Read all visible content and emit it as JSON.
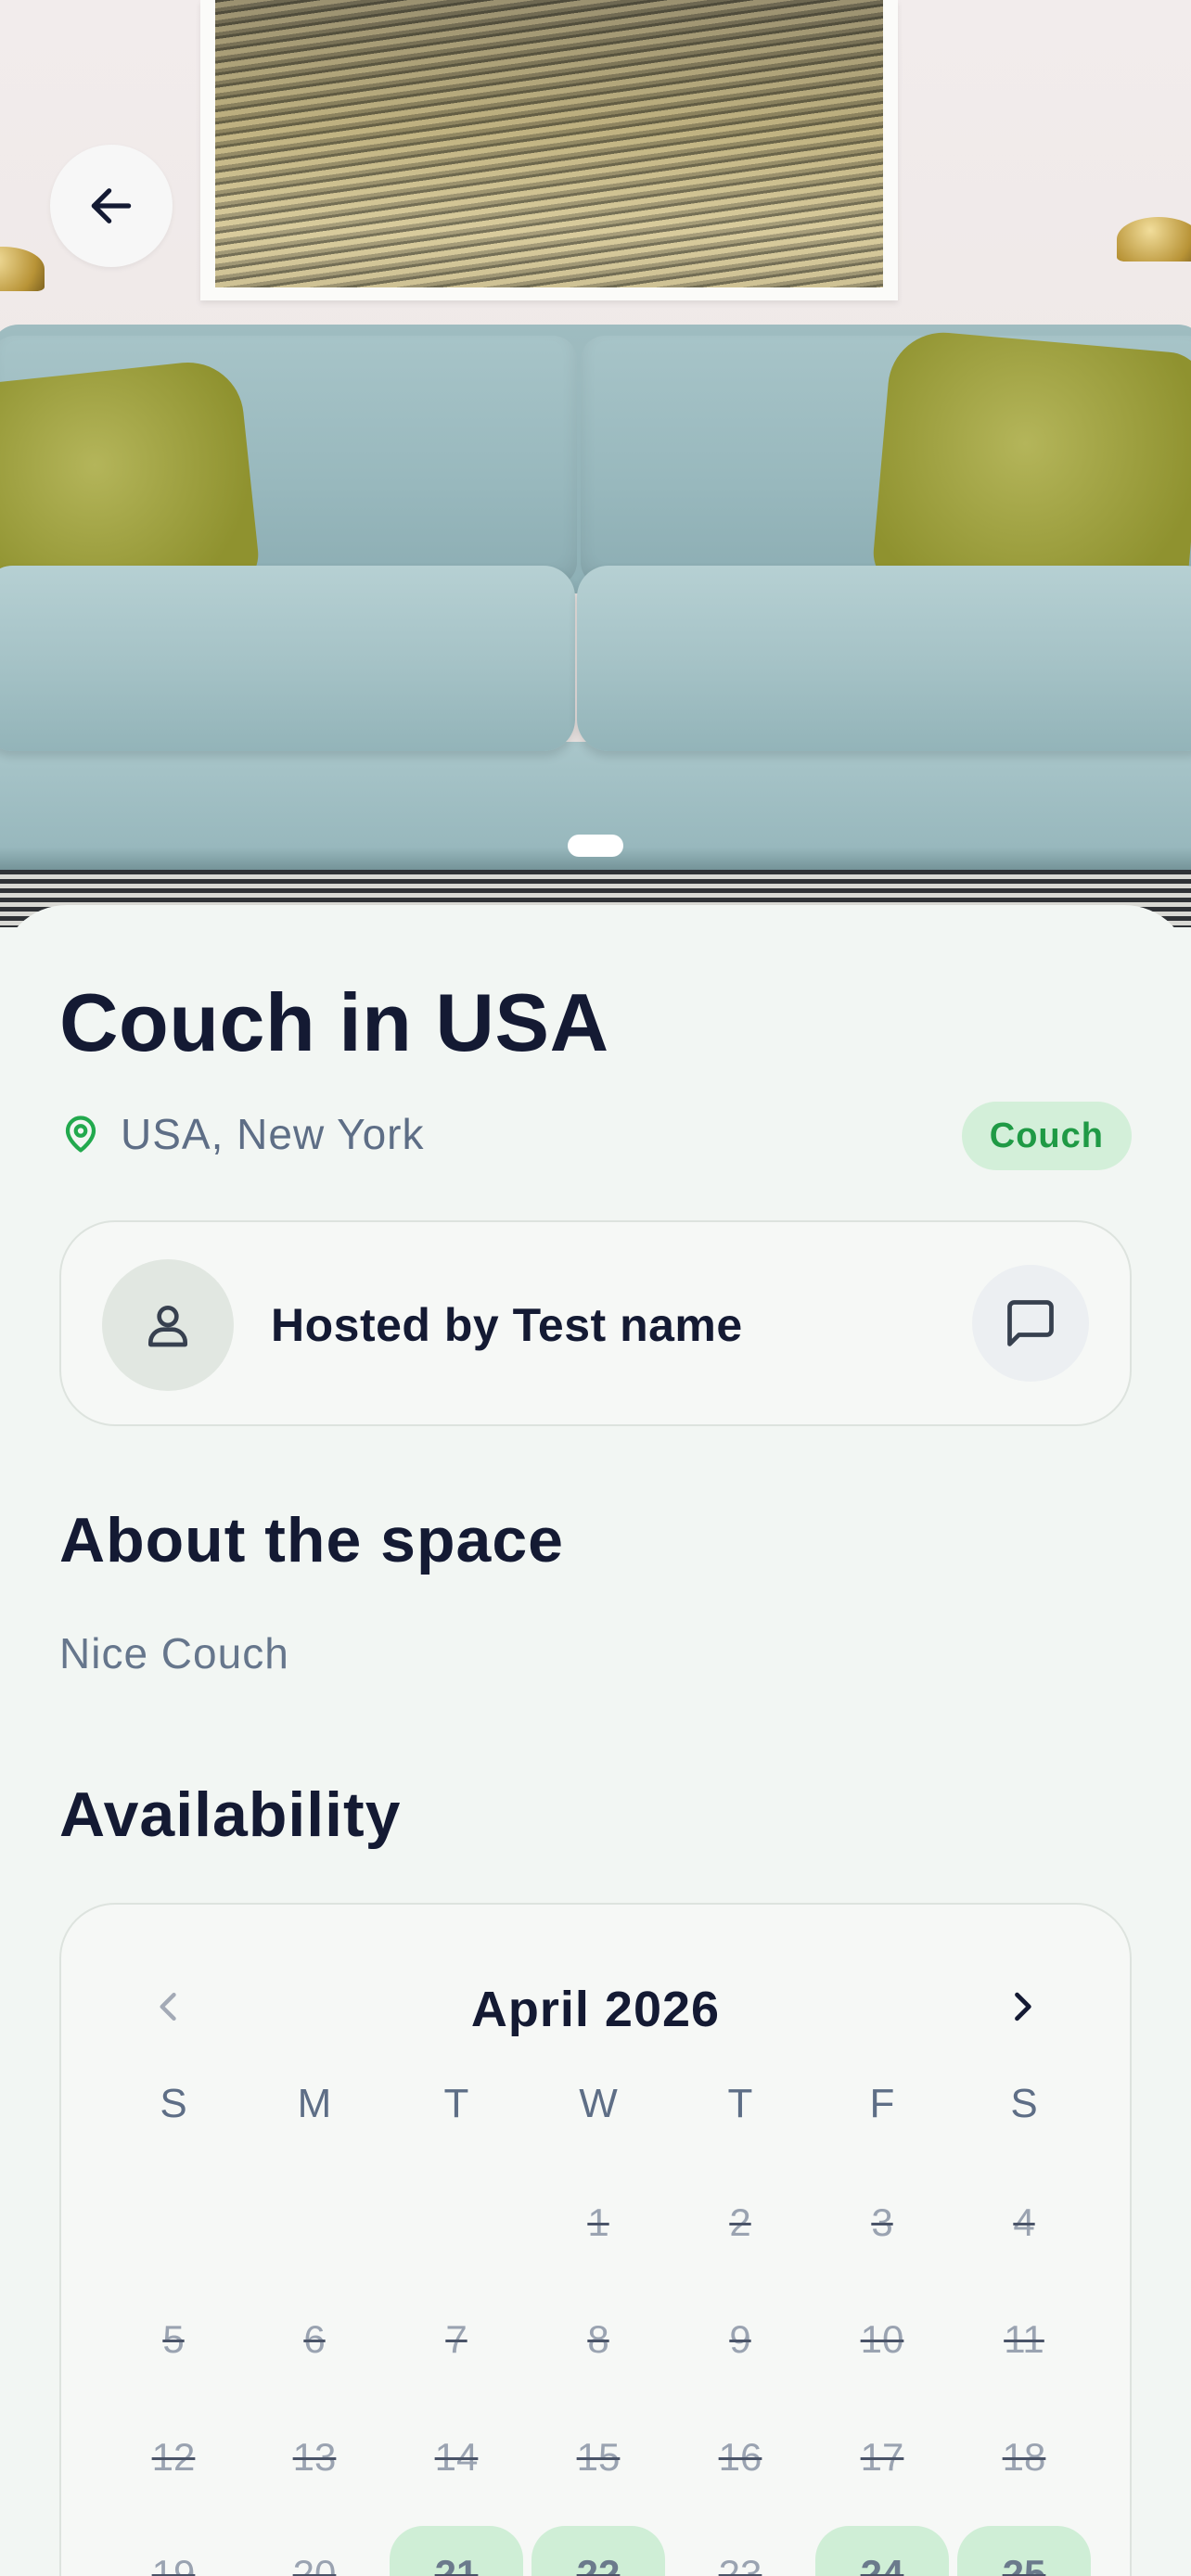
{
  "listing": {
    "title": "Couch in USA",
    "location": "USA, New York",
    "type_badge": "Couch"
  },
  "host": {
    "label": "Hosted by Test name"
  },
  "about": {
    "heading": "About the space",
    "text": "Nice Couch"
  },
  "availability": {
    "heading": "Availability",
    "month": "April 2026",
    "weekdays": [
      "S",
      "M",
      "T",
      "W",
      "T",
      "F",
      "S"
    ],
    "weeks": [
      [
        "",
        "",
        "",
        "1",
        "2",
        "3",
        "4"
      ],
      [
        "5",
        "6",
        "7",
        "8",
        "9",
        "10",
        "11"
      ],
      [
        "12",
        "13",
        "14",
        "15",
        "16",
        "17",
        "18"
      ],
      [
        "19",
        "20",
        "21",
        "22",
        "23",
        "24",
        "25"
      ]
    ],
    "highlighted_days": [
      "21",
      "22",
      "24",
      "25"
    ]
  },
  "colors": {
    "accent_green": "#1f9a45",
    "badge_bg": "#d3efd9",
    "highlight_bg": "#cfeed6",
    "text_dark": "#141a33",
    "text_muted": "#5e6e86"
  },
  "icons": {
    "back": "arrow-left-icon",
    "location": "map-pin-icon",
    "avatar": "user-icon",
    "message": "chat-bubble-icon",
    "prev_month": "chevron-left-icon",
    "next_month": "chevron-right-icon"
  }
}
